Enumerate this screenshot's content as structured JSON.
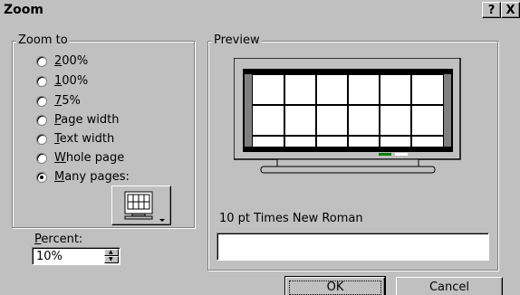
{
  "dialog": {
    "title": "Zoom",
    "help_button": "?",
    "close_button": "X"
  },
  "zoom_to": {
    "legend": "Zoom to",
    "options": [
      {
        "label": "200%",
        "mnemonic": "2",
        "selected": false
      },
      {
        "label": "100%",
        "mnemonic": "1",
        "selected": false
      },
      {
        "label": "75%",
        "mnemonic": "7",
        "selected": false
      },
      {
        "label": "Page width",
        "mnemonic": "P",
        "selected": false
      },
      {
        "label": "Text width",
        "mnemonic": "T",
        "selected": false
      },
      {
        "label": "Whole page",
        "mnemonic": "W",
        "selected": false
      },
      {
        "label": "Many pages:",
        "mnemonic": "M",
        "selected": true
      }
    ]
  },
  "percent": {
    "label": "Percent:",
    "value": "10%"
  },
  "preview": {
    "legend": "Preview",
    "font_caption": "10 pt Times New Roman"
  },
  "buttons": {
    "ok": "OK",
    "cancel": "Cancel"
  }
}
